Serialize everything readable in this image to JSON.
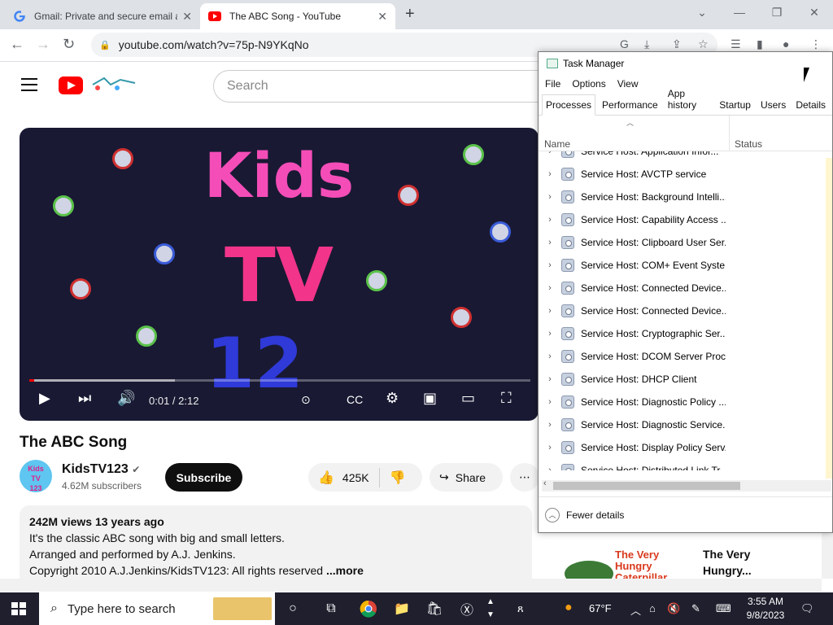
{
  "browser": {
    "tabs": [
      {
        "title": "Gmail: Private and secure email at no cost | Google",
        "favicon": "google-g-icon"
      },
      {
        "title": "The ABC Song - YouTube",
        "favicon": "youtube-icon"
      }
    ],
    "new_tab": "+",
    "url": "youtube.com/watch?v=75p-N9YKqNo"
  },
  "youtube": {
    "search_placeholder": "Search",
    "player": {
      "line1": "Kids",
      "line2": "TV",
      "line3": "12",
      "time": "0:01 / 2:12",
      "progress_fraction": 0.01,
      "buffered_fraction": 0.29
    },
    "video_title": "The ABC Song",
    "channel": {
      "name": "KidsTV123",
      "avatar_line1": "Kids",
      "avatar_line2": "TV",
      "avatar_line3": "123",
      "subscribers": "4.62M subscribers"
    },
    "subscribe_label": "Subscribe",
    "likes": "425K",
    "share_label": "Share",
    "description": {
      "meta": "242M views  13 years ago",
      "line1": "It's the classic ABC song with big and small letters.",
      "line2": "Arranged and performed by A.J. Jenkins.",
      "line3": "Copyright 2010 A.J.Jenkins/KidsTV123: All rights reserved",
      "more": "...more"
    },
    "recommendation": {
      "thumb_text": "The Very Hungry Caterpillar",
      "title_line1": "The Very",
      "title_line2": "Hungry..."
    }
  },
  "task_manager": {
    "title": "Task Manager",
    "menu": [
      "File",
      "Options",
      "View"
    ],
    "tabs": [
      "Processes",
      "Performance",
      "App history",
      "Startup",
      "Users",
      "Details"
    ],
    "columns": {
      "name": "Name",
      "status": "Status"
    },
    "processes": [
      "Service Host: Application Infor...",
      "Service Host: AVCTP service",
      "Service Host: Background Intelli...",
      "Service Host: Capability Access ...",
      "Service Host: Clipboard User Ser...",
      "Service Host: COM+ Event Syste...",
      "Service Host: Connected Device...",
      "Service Host: Connected Device...",
      "Service Host: Cryptographic Ser...",
      "Service Host: DCOM Server Proc...",
      "Service Host: DHCP Client",
      "Service Host: Diagnostic Policy ...",
      "Service Host: Diagnostic Service...",
      "Service Host: Display Policy Serv...",
      "Service Host: Distributed Link Tr..."
    ],
    "footer": "Fewer details"
  },
  "taskbar": {
    "search_placeholder": "Type here to search",
    "weather": "67°F",
    "time": "3:55 AM",
    "date": "9/8/2023"
  }
}
